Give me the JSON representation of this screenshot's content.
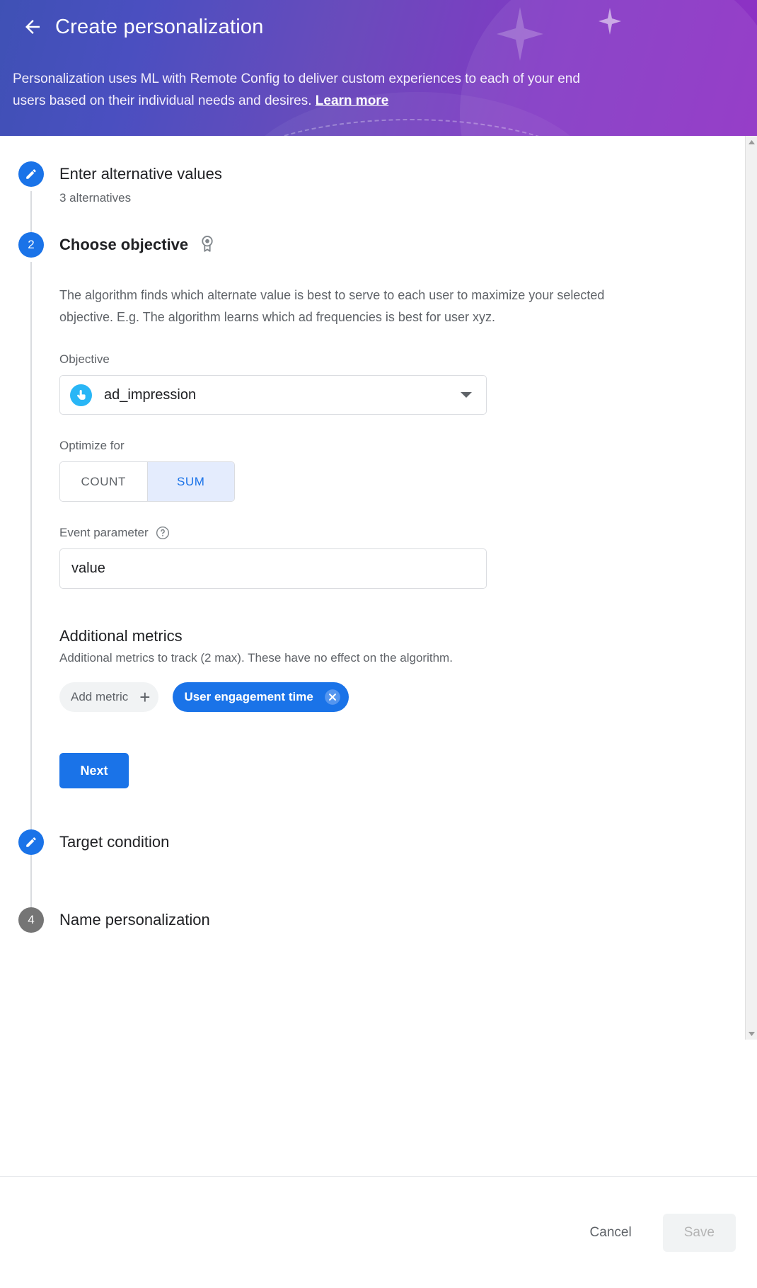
{
  "header": {
    "back_icon": "arrow-left-icon",
    "title": "Create personalization",
    "description_part1": "Personalization uses ML with Remote Config to deliver custom experiences to each of your end users based on their individual needs and desires. ",
    "learn_more": "Learn more",
    "gradient_from": "#3f51b5",
    "gradient_to": "#8e30c4"
  },
  "steps": {
    "step1": {
      "marker": "edit-pencil-icon",
      "title": "Enter alternative values",
      "subtitle": "3 alternatives"
    },
    "step2": {
      "marker": "2",
      "title": "Choose objective",
      "badge_icon": "award-medal-icon",
      "description": "The algorithm finds which alternate value is best to serve to each user to maximize your selected objective. E.g. The algorithm learns which ad frequencies is best for user xyz.",
      "objective_label": "Objective",
      "objective_value": "ad_impression",
      "objective_icon": "touch-tap-icon",
      "objective_icon_color": "#29b6f6",
      "dropdown_icon": "chevron-down-icon",
      "optimize_label": "Optimize for",
      "optimize_options": [
        {
          "label": "COUNT",
          "selected": false
        },
        {
          "label": "SUM",
          "selected": true
        }
      ],
      "event_param_label": "Event parameter",
      "event_param_help_icon": "help-circle-icon",
      "event_param_value": "value",
      "additional_metrics_title": "Additional metrics",
      "additional_metrics_sub": "Additional metrics to track (2 max). These have no effect on the algorithm.",
      "add_metric_label": "Add metric",
      "add_metric_icon": "plus-icon",
      "selected_metric_label": "User engagement time",
      "selected_metric_remove_icon": "close-circle-icon",
      "next_label": "Next",
      "accent_color": "#1a73e8"
    },
    "step3": {
      "marker": "edit-pencil-icon",
      "title": "Target condition"
    },
    "step4": {
      "marker": "4",
      "title": "Name personalization"
    }
  },
  "scrollbar": {
    "up_icon": "triangle-up-icon",
    "down_icon": "triangle-down-icon"
  },
  "footer": {
    "cancel_label": "Cancel",
    "save_label": "Save"
  }
}
